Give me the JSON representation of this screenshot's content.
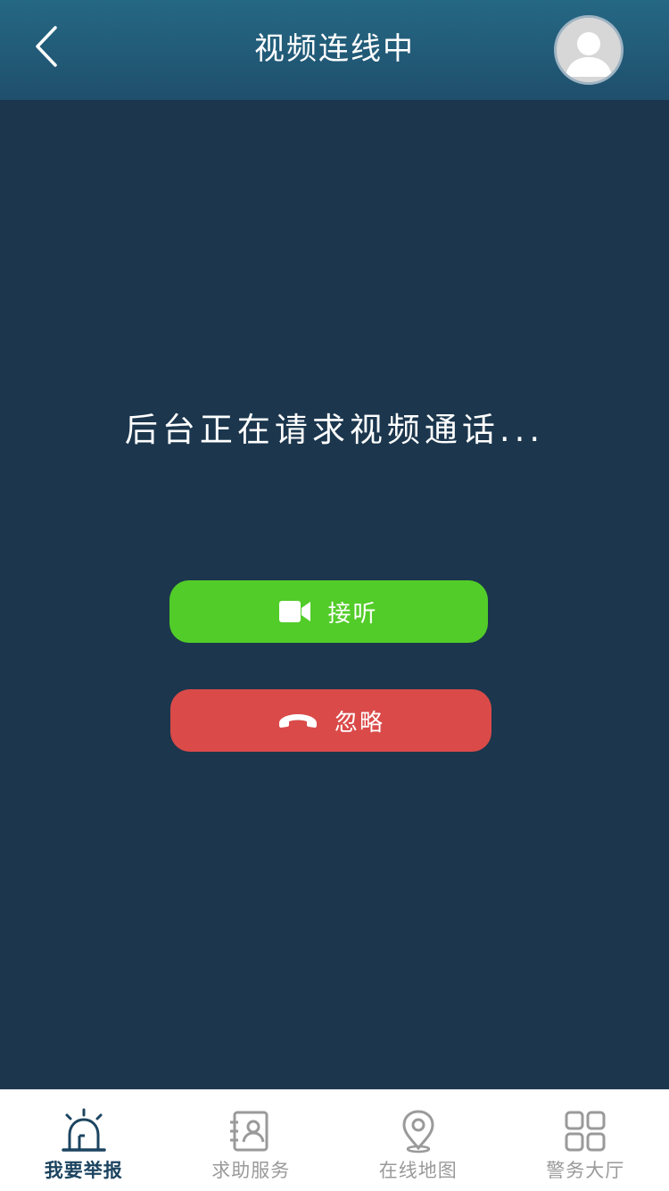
{
  "header": {
    "title": "视频连线中",
    "back_icon": "chevron-left-icon",
    "avatar_icon": "user-avatar-icon"
  },
  "call": {
    "status_text": "后台正在请求视频通话...",
    "answer_label": "接听",
    "answer_icon": "video-camera-icon",
    "ignore_label": "忽略",
    "ignore_icon": "phone-hangup-icon"
  },
  "tabs": [
    {
      "label": "我要举报",
      "icon": "alarm-siren-icon",
      "active": true
    },
    {
      "label": "求助服务",
      "icon": "contact-card-icon",
      "active": false
    },
    {
      "label": "在线地图",
      "icon": "map-pin-icon",
      "active": false
    },
    {
      "label": "警务大厅",
      "icon": "grid-apps-icon",
      "active": false
    }
  ],
  "colors": {
    "header": "#1f4f6c",
    "background": "#1b364d",
    "answer_button": "#52cc28",
    "ignore_button": "#da4a49",
    "tab_active": "#1c4460",
    "tab_inactive": "#9a9a9a"
  }
}
